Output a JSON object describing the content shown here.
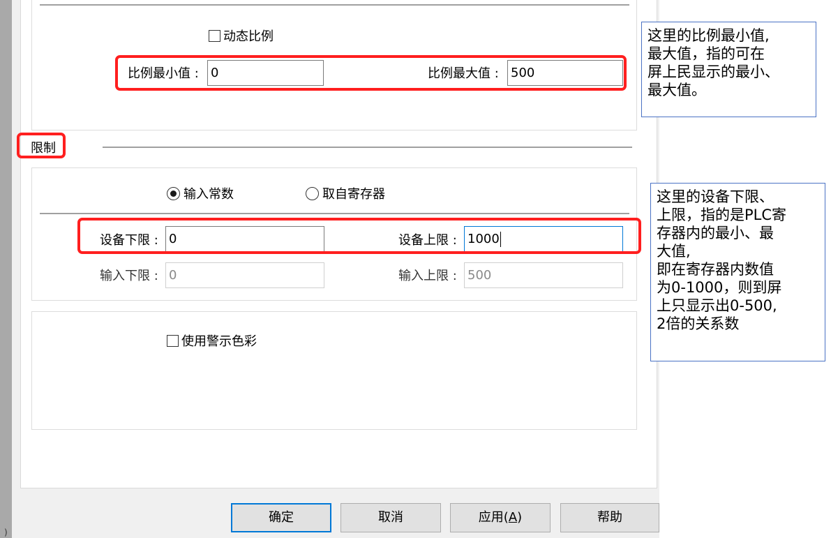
{
  "scale": {
    "dynamic_ratio_label": "动态比例",
    "ratio_min_label": "比例最小值 :",
    "ratio_min_value": "0",
    "ratio_max_label": "比例最大值 :",
    "ratio_max_value": "500"
  },
  "limits": {
    "section_title": "限制",
    "radio_constant_label": "输入常数",
    "radio_register_label": "取自寄存器",
    "device_low_label": "设备下限 :",
    "device_low_value": "0",
    "device_high_label": "设备上限 :",
    "device_high_value": "1000",
    "input_low_label": "输入下限 :",
    "input_low_value": "0",
    "input_high_label": "输入上限 :",
    "input_high_value": "500"
  },
  "warning": {
    "use_warning_color_label": "使用警示色彩"
  },
  "buttons": {
    "ok_label": "确定",
    "cancel_label": "取消",
    "apply_label": "应用(",
    "apply_mnemonic": "A",
    "apply_suffix": ")",
    "help_label": "帮助"
  },
  "notes": {
    "note1": "这里的比例最小值,\n最大值，指的可在\n屏上民显示的最小、\n最大值。",
    "note2": "这里的设备下限、\n上限，指的是PLC寄\n存器内的最小、最\n大值,\n即在寄存器内数值\n为0-1000，则到屏\n上只显示出0-500,\n2倍的关系数"
  },
  "left_strip_char": ")"
}
